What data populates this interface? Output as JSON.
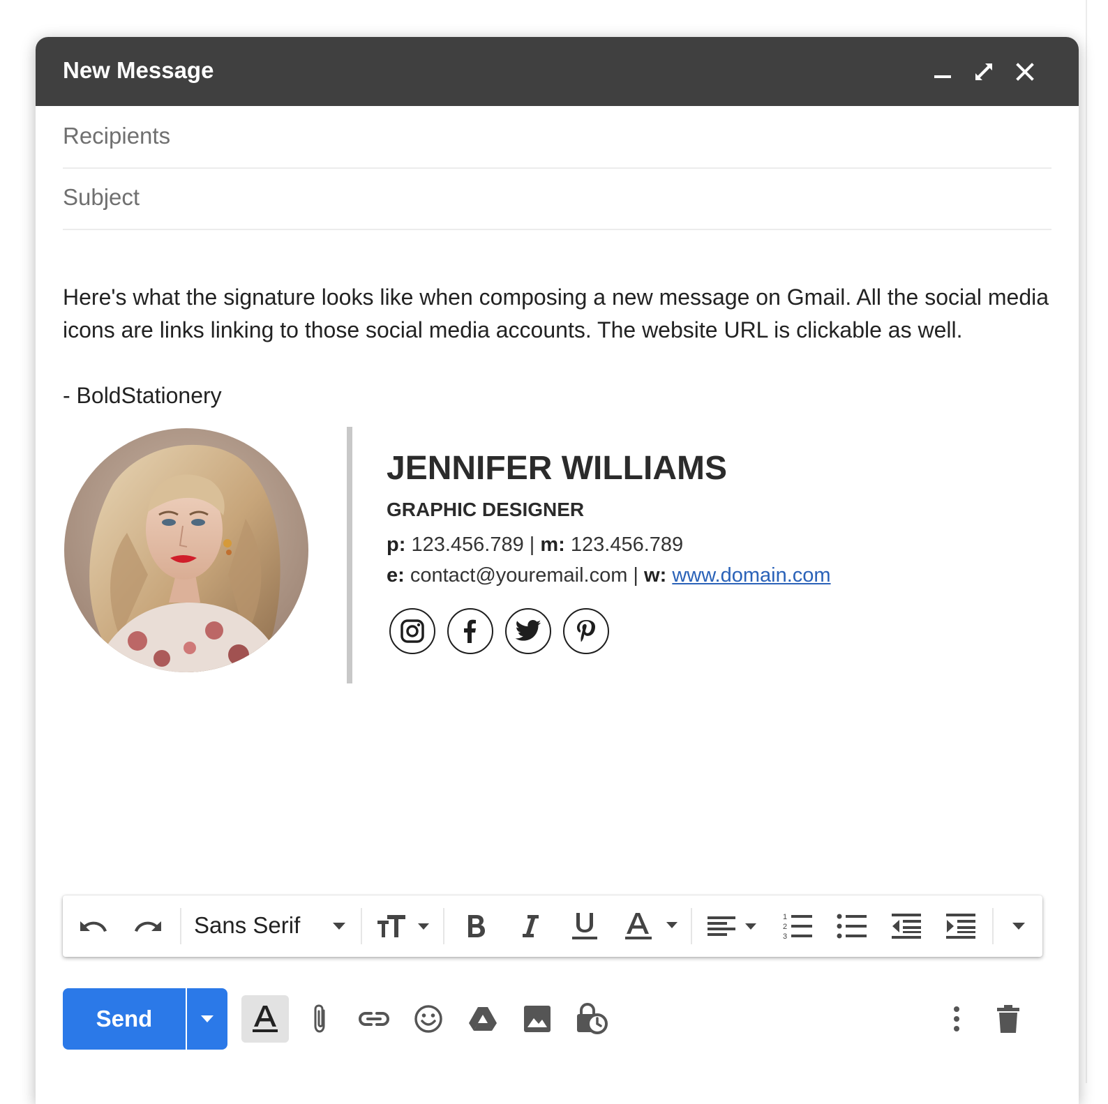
{
  "window": {
    "title": "New Message",
    "controls": [
      "minimize-icon",
      "expand-icon",
      "close-icon"
    ]
  },
  "fields": {
    "recipients_placeholder": "Recipients",
    "subject_placeholder": "Subject"
  },
  "body": {
    "paragraph": "Here's what the signature looks like when composing a new message on Gmail. All the social media icons are links linking to those social media accounts. The website URL is clickable as well.",
    "sign_off": "- BoldStationery"
  },
  "signature": {
    "name": "JENNIFER WILLIAMS",
    "job_title": "GRAPHIC DESIGNER",
    "phone_label": "p:",
    "phone": "123.456.789",
    "mobile_label": "m:",
    "mobile": "123.456.789",
    "email_label": "e:",
    "email": "contact@youremail.com",
    "separator": "|",
    "web_label": "w:",
    "website": "www.domain.com",
    "social_icons": [
      "instagram-icon",
      "facebook-icon",
      "twitter-icon",
      "pinterest-icon"
    ]
  },
  "formatting_toolbar": {
    "font": "Sans Serif",
    "icons": [
      "undo-icon",
      "redo-icon",
      "font-family-dropdown",
      "text-size-icon",
      "bold-icon",
      "italic-icon",
      "underline-icon",
      "text-color-icon",
      "align-icon",
      "numbered-list-icon",
      "bulleted-list-icon",
      "indent-less-icon",
      "indent-more-icon",
      "more-formatting-icon"
    ]
  },
  "bottom_toolbar": {
    "send_label": "Send",
    "icons": [
      "send-options-icon",
      "formatting-options-icon",
      "attach-icon",
      "link-icon",
      "emoji-icon",
      "drive-icon",
      "photo-icon",
      "confidential-icon",
      "more-options-icon",
      "trash-icon"
    ]
  },
  "colors": {
    "titlebar": "#404040",
    "send_button": "#2b79e8",
    "link": "#2a62b8"
  }
}
